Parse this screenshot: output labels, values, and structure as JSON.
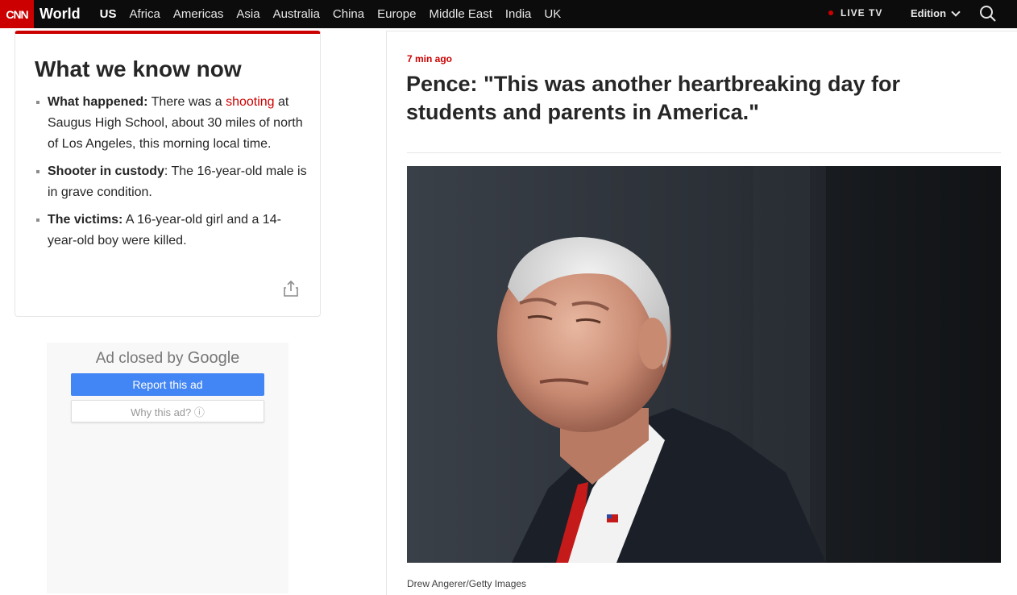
{
  "nav": {
    "logo": "CNN",
    "section": "World",
    "items": [
      "US",
      "Africa",
      "Americas",
      "Asia",
      "Australia",
      "China",
      "Europe",
      "Middle East",
      "India",
      "UK"
    ],
    "live_tv": "LIVE TV",
    "edition": "Edition"
  },
  "know_now": {
    "title": "What we know now",
    "items": [
      {
        "label": "What happened:",
        "pre": " There was a ",
        "link": "shooting",
        "post": " at Saugus High School, about 30 miles of north of Los Angeles, this morning local time."
      },
      {
        "label": "Shooter in custody",
        "pre": ": The 16-year-old male is in grave condition.",
        "link": "",
        "post": ""
      },
      {
        "label": "The victims:",
        "pre": " A 16-year-old girl and a 14-year-old boy were killed.",
        "link": "",
        "post": ""
      }
    ]
  },
  "ad": {
    "closed_prefix": "Ad closed by ",
    "closed_brand": "Google",
    "report": "Report this ad",
    "why": "Why this ad? ⓘ"
  },
  "post": {
    "time": "7 min ago",
    "headline": "Pence: \"This was another heartbreaking day for students and parents in America.\"",
    "caption": "Drew Angerer/Getty Images"
  },
  "colors": {
    "brand": "#cc0000",
    "nav_bg": "#0c0c0c",
    "ad_button": "#4285f4"
  }
}
